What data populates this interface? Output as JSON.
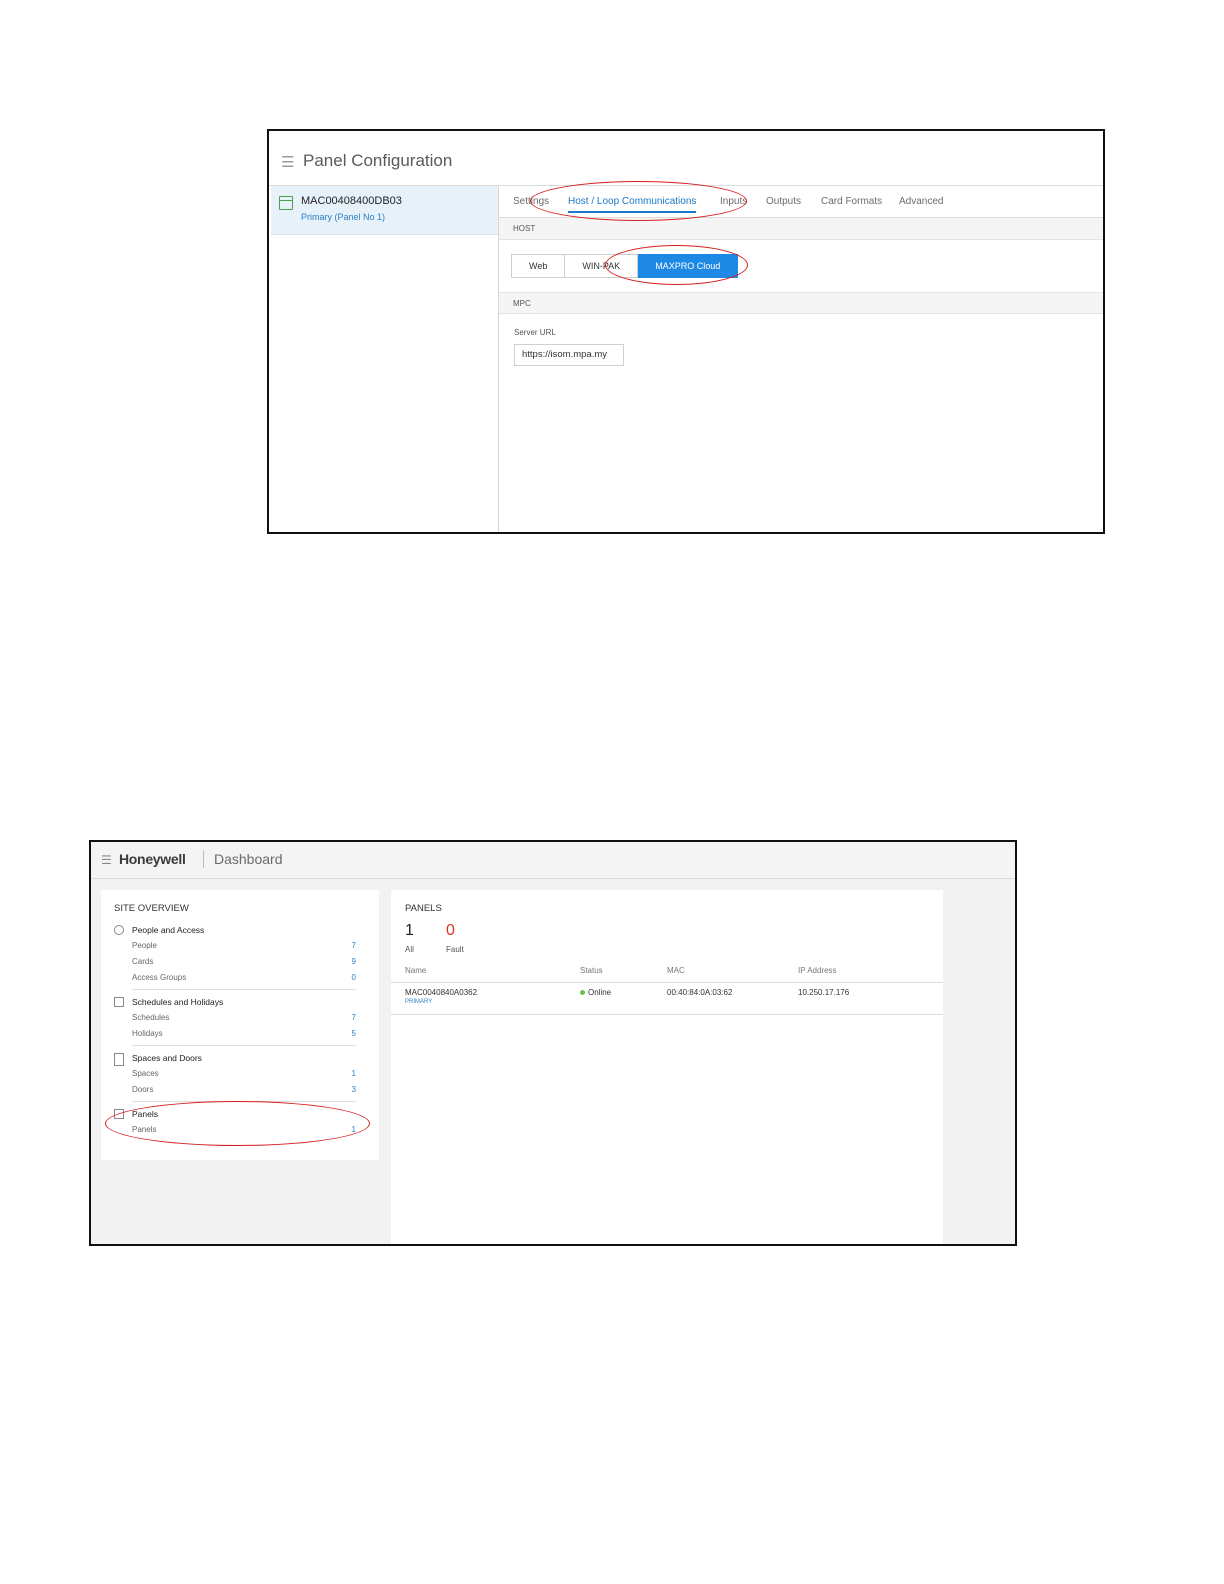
{
  "panel_config": {
    "title": "Panel Configuration",
    "device": {
      "name": "MAC00408400DB03",
      "subtitle": "Primary (Panel No 1)"
    },
    "tabs": [
      {
        "label": "Settings",
        "active": false
      },
      {
        "label": "Host / Loop Communications",
        "active": true
      },
      {
        "label": "Inputs",
        "active": false
      },
      {
        "label": "Outputs",
        "active": false
      },
      {
        "label": "Card Formats",
        "active": false
      },
      {
        "label": "Advanced",
        "active": false
      }
    ],
    "host_section": "HOST",
    "host_options": [
      {
        "label": "Web",
        "selected": false
      },
      {
        "label": "WIN-PAK",
        "selected": false
      },
      {
        "label": "MAXPRO Cloud",
        "selected": true
      }
    ],
    "mpc_section": "MPC",
    "server_url": {
      "label": "Server URL",
      "value": "https://isom.mpa.my"
    }
  },
  "dashboard": {
    "brand": "Honeywell",
    "title": "Dashboard",
    "site_overview": {
      "title": "SITE OVERVIEW",
      "groups": [
        {
          "name": "People and Access",
          "icon": "person-icon",
          "items": [
            {
              "label": "People",
              "value": "7"
            },
            {
              "label": "Cards",
              "value": "9"
            },
            {
              "label": "Access Groups",
              "value": "0"
            }
          ]
        },
        {
          "name": "Schedules and Holidays",
          "icon": "calendar-icon",
          "items": [
            {
              "label": "Schedules",
              "value": "7"
            },
            {
              "label": "Holidays",
              "value": "5"
            }
          ]
        },
        {
          "name": "Spaces and Doors",
          "icon": "door-icon",
          "items": [
            {
              "label": "Spaces",
              "value": "1"
            },
            {
              "label": "Doors",
              "value": "3"
            }
          ]
        },
        {
          "name": "Panels",
          "icon": "panel-icon",
          "items": [
            {
              "label": "Panels",
              "value": "1"
            }
          ]
        }
      ]
    },
    "panels": {
      "title": "PANELS",
      "all_count": "1",
      "all_label": "All",
      "fault_count": "0",
      "fault_label": "Fault",
      "columns": [
        "Name",
        "Status",
        "MAC",
        "IP Address"
      ],
      "rows": [
        {
          "name": "MAC0040840A0362",
          "tag": "PRIMARY",
          "status": "Online",
          "mac": "00:40:84:0A:03:62",
          "ip": "10.250.17.176"
        }
      ]
    }
  },
  "colors": {
    "accent": "#1e88e5",
    "link": "#2b7fc3",
    "fault": "#d9361e",
    "online": "#6cc24a",
    "highlight": "#d61e1e"
  }
}
